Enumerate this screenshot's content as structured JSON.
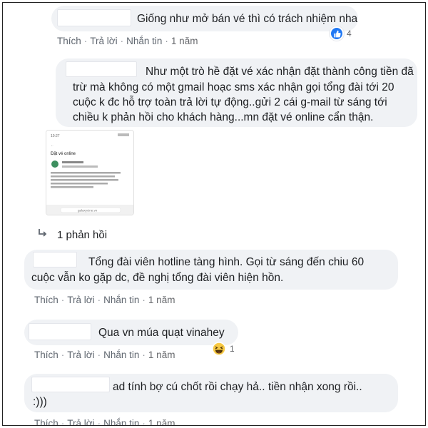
{
  "actions": {
    "like": "Thích",
    "reply": "Trả lời",
    "message": "Nhắn tin",
    "time": "1 năm",
    "dot": "·"
  },
  "comments": [
    {
      "text_lines": [
        "Giống như mở bán vé thì có trách nhiệm nha"
      ],
      "reaction": {
        "type": "like",
        "count": "4"
      }
    },
    {
      "text_lines": [
        "Như một trò hề đặt vé xác nhận đặt thành công tiền đã",
        "trừ mà không có một gmail hoạc sms xác nhận gọi tổng đài tới 20",
        "cuộc k đc hỗ trợ toàn trả lời tự động..gửi 2 cái g-mail từ sáng tới",
        "chiều k phản hồi cho khách hàng...mn đặt vé online cẩn thận."
      ],
      "attachment": {
        "status_time": "10:27",
        "title": "Đặt vé online",
        "sender": "info@ticketbox.com.vn",
        "body": "Tôi có đặt một vé online phim avengers endgame web thông báo đặt vé thành công nhưng tôi không nhận được tin nhắn hoặc email xác nhận vé",
        "url": "galaxycine.vn"
      },
      "replies": {
        "label": "1 phản hồi"
      }
    },
    {
      "text_lines": [
        "Tổng đài viên hotline tàng hình. Gọi từ sáng đến chiu 60",
        "cuộc vẫn ko gặp dc, đề nghị tổng đài viên hiện hồn."
      ]
    },
    {
      "text_lines": [
        "Qua vn múa quạt vinahey"
      ],
      "reaction": {
        "type": "haha",
        "count": "1"
      }
    },
    {
      "text_lines": [
        "ad tính bợ cú chốt rồi chạy hả.. tiền nhận xong rồi..",
        ":)))"
      ]
    }
  ]
}
